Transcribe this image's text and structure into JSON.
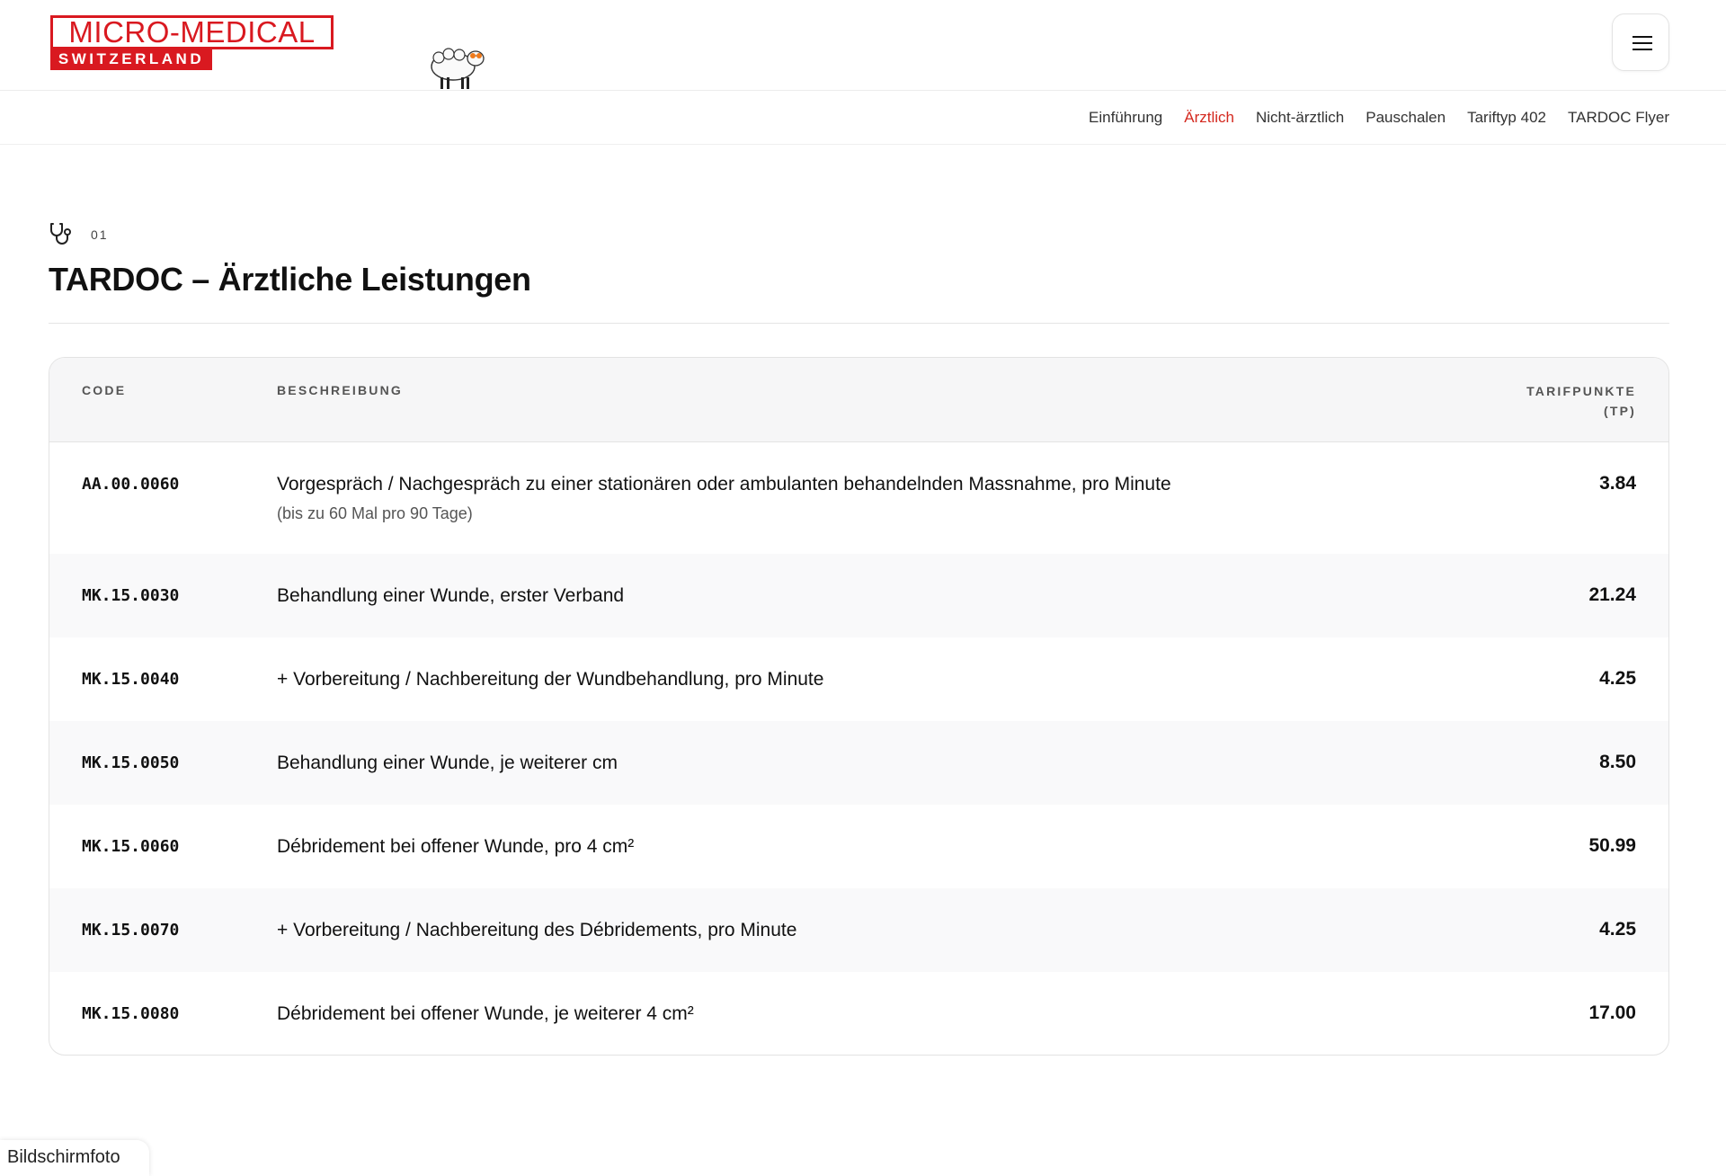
{
  "header": {
    "logo_top": "MICRO-MEDICAL",
    "logo_bottom": "SWITZERLAND",
    "menu_icon": "hamburger-icon"
  },
  "nav": {
    "items": [
      {
        "label": "Einführung",
        "active": false
      },
      {
        "label": "Ärztlich",
        "active": true
      },
      {
        "label": "Nicht-ärztlich",
        "active": false
      },
      {
        "label": "Pauschalen",
        "active": false
      },
      {
        "label": "Tariftyp 402",
        "active": false
      },
      {
        "label": "TARDOC Flyer",
        "active": false
      }
    ],
    "active_color": "#d4291f"
  },
  "section": {
    "icon": "stethoscope-icon",
    "number": "01",
    "title": "TARDOC – Ärztliche Leistungen"
  },
  "table": {
    "headers": {
      "code": "CODE",
      "description": "BESCHREIBUNG",
      "tp_line1": "TARIFPUNKTE",
      "tp_line2": "(TP)"
    },
    "rows": [
      {
        "code": "AA.00.0060",
        "description": "Vorgespräch / Nachgespräch zu einer stationären oder ambulanten behandelnden Massnahme, pro Minute",
        "note": "(bis zu 60 Mal pro 90 Tage)",
        "tp": "3.84"
      },
      {
        "code": "MK.15.0030",
        "description": "Behandlung einer Wunde, erster Verband",
        "tp": "21.24"
      },
      {
        "code": "MK.15.0040",
        "description": "+ Vorbereitung / Nachbereitung der Wundbehandlung, pro Minute",
        "tp": "4.25"
      },
      {
        "code": "MK.15.0050",
        "description": "Behandlung einer Wunde, je weiterer cm",
        "tp": "8.50"
      },
      {
        "code": "MK.15.0060",
        "description": "Débridement bei offener Wunde, pro 4 cm²",
        "tp": "50.99"
      },
      {
        "code": "MK.15.0070",
        "description": "+ Vorbereitung / Nachbereitung des Débridements, pro Minute",
        "tp": "4.25"
      },
      {
        "code": "MK.15.0080",
        "description": "Débridement bei offener Wunde, je weiterer 4 cm²",
        "tp": "17.00"
      }
    ]
  },
  "screenshot_label": "Bildschirmfoto",
  "colors": {
    "brand_red": "#d91920",
    "header_bg": "#f6f6f7",
    "alt_row_bg": "#f9f9fa"
  }
}
